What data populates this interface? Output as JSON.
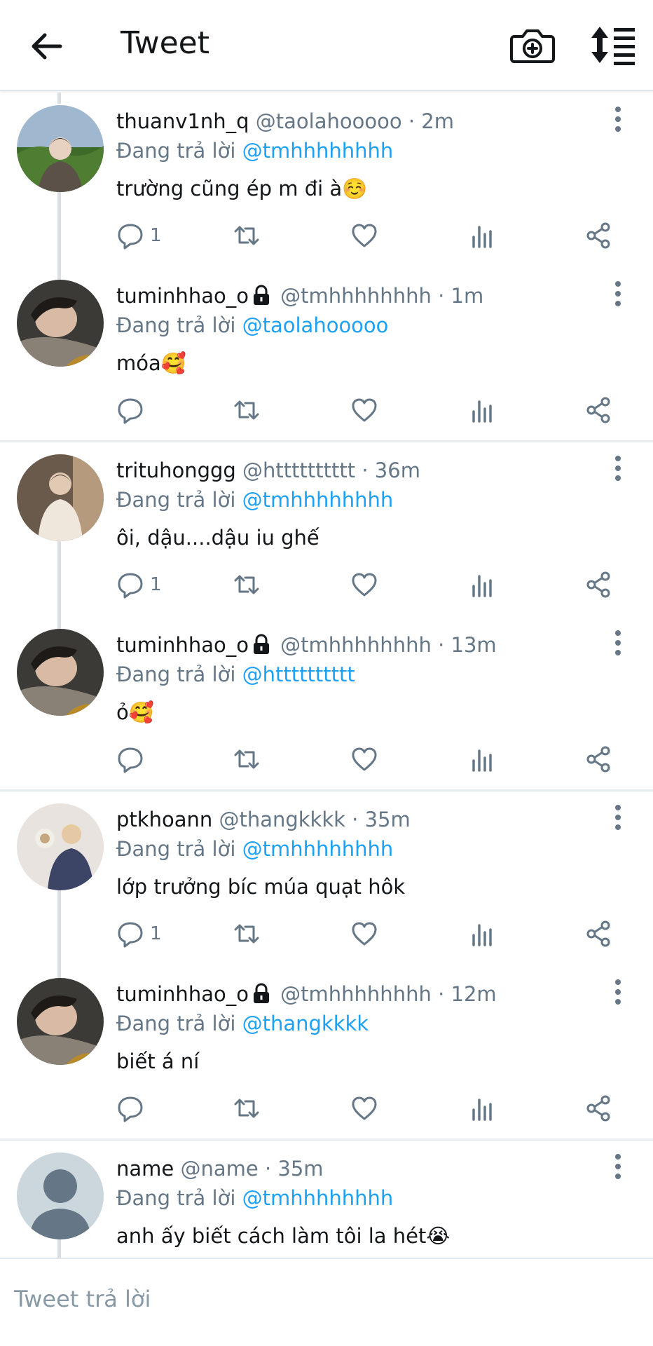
{
  "header": {
    "title": "Tweet",
    "back_icon": "arrow-left-icon",
    "camera_icon": "camera-plus-icon",
    "sort_icon": "sort-list-icon"
  },
  "colors": {
    "accent": "#1da1f2",
    "secondary_text": "#657786",
    "primary_text": "#14171a",
    "divider": "#e6ecf0"
  },
  "tweets": [
    {
      "display_name": "thuanv1nh_q",
      "locked": false,
      "handle": "@taolahooooo",
      "time": "2m",
      "reply_prefix": "Đang trả lời",
      "reply_to": "@tmhhhhhhhh",
      "text": " trường cũng ép m đi à☺️",
      "replies": "1"
    },
    {
      "display_name": "tuminhhao_o",
      "locked": true,
      "handle": "@tmhhhhhhhh",
      "time": "1m",
      "reply_prefix": "Đang trả lời",
      "reply_to": "@taolahooooo",
      "text": "móa🥰",
      "replies": ""
    },
    {
      "display_name": "trituhonggg",
      "locked": false,
      "handle": "@htttttttttt",
      "time": "36m",
      "reply_prefix": "Đang trả lời",
      "reply_to": "@tmhhhhhhhh",
      "text": "ôi, dậu....dậu iu ghế",
      "replies": "1"
    },
    {
      "display_name": "tuminhhao_o",
      "locked": true,
      "handle": "@tmhhhhhhhh",
      "time": "13m",
      "reply_prefix": "Đang trả lời",
      "reply_to": "@htttttttttt",
      "text": "ỏ🥰",
      "replies": ""
    },
    {
      "display_name": "ptkhoann",
      "locked": false,
      "handle": "@thangkkkk",
      "time": "35m",
      "reply_prefix": "Đang trả lời",
      "reply_to": "@tmhhhhhhhh",
      "text": "lớp trưởng bíc múa quạt hôk",
      "replies": "1"
    },
    {
      "display_name": "tuminhhao_o",
      "locked": true,
      "handle": "@tmhhhhhhhh",
      "time": "12m",
      "reply_prefix": "Đang trả lời",
      "reply_to": "@thangkkkk",
      "text": "biết á ní",
      "replies": ""
    },
    {
      "display_name": "name",
      "locked": false,
      "handle": "@name",
      "time": "35m",
      "reply_prefix": "Đang trả lời",
      "reply_to": "@tmhhhhhhhh",
      "text": "anh ấy biết cách làm tôi la hét😭",
      "replies": ""
    }
  ],
  "action_icons": [
    "reply-icon",
    "retweet-icon",
    "like-icon",
    "analytics-icon",
    "share-icon"
  ],
  "compose": {
    "placeholder": "Tweet trả lời"
  }
}
